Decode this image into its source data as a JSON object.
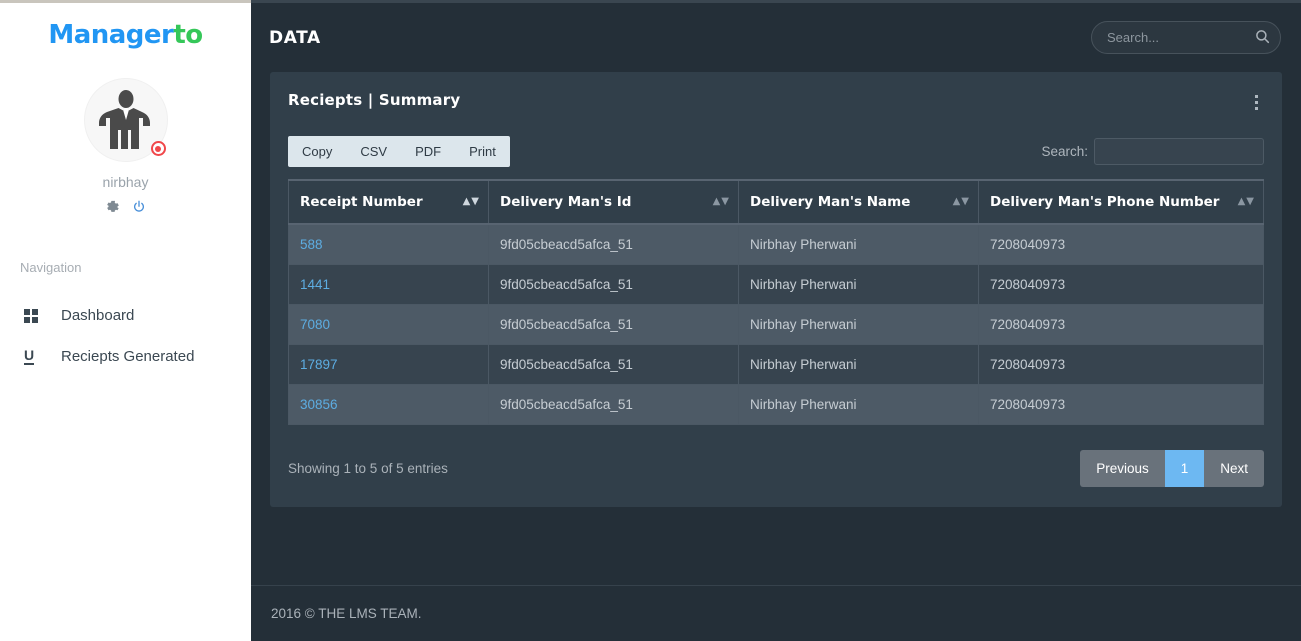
{
  "sidebar": {
    "logo": {
      "part1": "Manager",
      "part2": "to"
    },
    "profile": {
      "username": "nirbhay",
      "settings_icon": "gear-icon",
      "power_icon": "power-icon",
      "status": "offline"
    },
    "nav_title": "Navigation",
    "items": [
      {
        "label": "Dashboard",
        "icon": "grid-icon"
      },
      {
        "label": "Reciepts Generated",
        "icon": "underline-u-icon"
      }
    ]
  },
  "header": {
    "title": "DATA",
    "search": {
      "placeholder": "Search...",
      "value": "",
      "icon": "search-icon"
    }
  },
  "card": {
    "title": "Reciepts | Summary",
    "menu_icon": "kebab-menu-icon",
    "export_buttons": [
      "Copy",
      "CSV",
      "PDF",
      "Print"
    ],
    "search": {
      "label": "Search:",
      "value": "",
      "placeholder": ""
    },
    "table": {
      "columns": [
        {
          "label": "Receipt Number",
          "sorted": "asc"
        },
        {
          "label": "Delivery Man's Id",
          "sorted": "none"
        },
        {
          "label": "Delivery Man's Name",
          "sorted": "none"
        },
        {
          "label": "Delivery Man's Phone Number",
          "sorted": "none"
        }
      ],
      "rows": [
        {
          "receipt": "588",
          "id": "9fd05cbeacd5afca_51",
          "name": "Nirbhay Pherwani",
          "phone": "7208040973"
        },
        {
          "receipt": "1441",
          "id": "9fd05cbeacd5afca_51",
          "name": "Nirbhay Pherwani",
          "phone": "7208040973"
        },
        {
          "receipt": "7080",
          "id": "9fd05cbeacd5afca_51",
          "name": "Nirbhay Pherwani",
          "phone": "7208040973"
        },
        {
          "receipt": "17897",
          "id": "9fd05cbeacd5afca_51",
          "name": "Nirbhay Pherwani",
          "phone": "7208040973"
        },
        {
          "receipt": "30856",
          "id": "9fd05cbeacd5afca_51",
          "name": "Nirbhay Pherwani",
          "phone": "7208040973"
        }
      ]
    },
    "entries_info": "Showing 1 to 5 of 5 entries",
    "pagination": {
      "previous": "Previous",
      "pages": [
        "1"
      ],
      "next": "Next",
      "active": "1"
    }
  },
  "footer": {
    "text": "2016 © THE LMS TEAM."
  },
  "colors": {
    "body_bg": "#242f38",
    "card_bg": "#313f4a",
    "row_odd": "#4d5a66",
    "row_even": "#37444f",
    "accent_blue": "#6db8f2",
    "link_blue": "#5dade2",
    "logo_blue": "#2196f3",
    "logo_green": "#35c759",
    "status_red": "#f0474a"
  }
}
